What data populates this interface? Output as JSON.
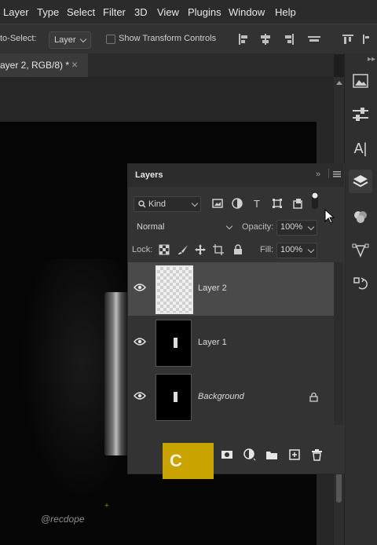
{
  "menu": [
    "Layer",
    "Type",
    "Select",
    "Filter",
    "3D",
    "View",
    "Plugins",
    "Window",
    "Help"
  ],
  "options": {
    "auto_select_label": "to-Select:",
    "auto_select_value": "Layer",
    "show_transform_label": "Show Transform Controls"
  },
  "doc_tab": {
    "title": "ayer 2, RGB/8) *",
    "close": "×"
  },
  "watermark": "@recdope",
  "layers_panel": {
    "title": "Layers",
    "kind_label": "Kind",
    "blend_mode": "Normal",
    "opacity_label": "Opacity:",
    "opacity_value": "100%",
    "lock_label": "Lock:",
    "fill_label": "Fill:",
    "fill_value": "100%",
    "layers": [
      {
        "name": "Layer 2",
        "selected": true,
        "visible": true
      },
      {
        "name": "Layer 1",
        "selected": false,
        "visible": true
      },
      {
        "name": "Background",
        "selected": false,
        "visible": true,
        "locked": true
      }
    ]
  },
  "key_overlay": {
    "label": "C",
    "color": "#c9a400"
  }
}
